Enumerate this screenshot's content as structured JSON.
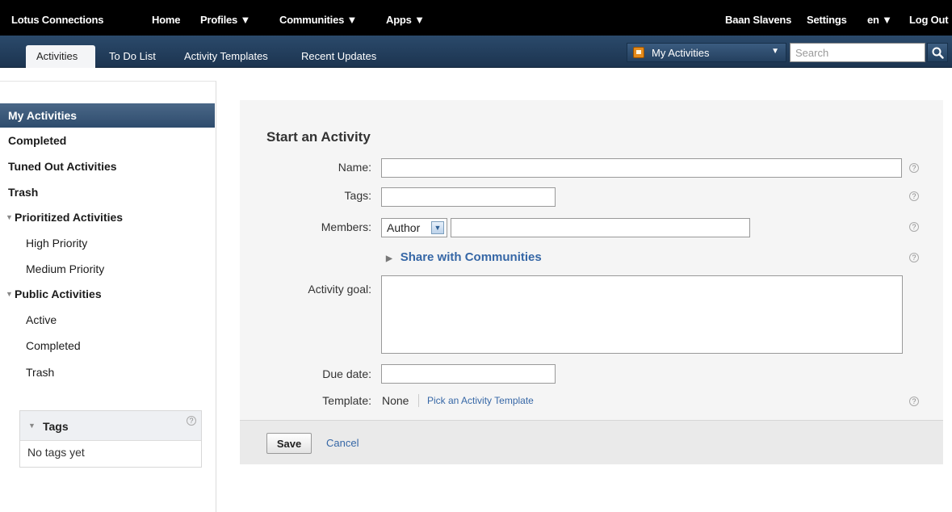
{
  "topbar": {
    "brand": "Lotus Connections",
    "nav": [
      "Home",
      "Profiles ▼",
      "Communities ▼",
      "Apps ▼"
    ],
    "user": "Baan Slavens",
    "settings": "Settings",
    "language": "en ▼",
    "logout": "Log Out"
  },
  "tabs": [
    "Activities",
    "To Do List",
    "Activity Templates",
    "Recent Updates"
  ],
  "context_select": "My Activities",
  "search": {
    "placeholder": "Search"
  },
  "sidebar": {
    "items": [
      "My Activities",
      "Completed",
      "Tuned Out Activities",
      "Trash",
      "Prioritized Activities",
      "High Priority",
      "Medium Priority",
      "Public Activities",
      "Active",
      "Completed",
      "Trash"
    ]
  },
  "tags_widget": {
    "title": "Tags",
    "empty": "No tags yet"
  },
  "help_glyph": "?",
  "form": {
    "title": "Start an Activity",
    "labels": {
      "name": "Name:",
      "tags": "Tags:",
      "members": "Members:",
      "goal": "Activity goal:",
      "due": "Due date:",
      "template": "Template:"
    },
    "member_role": "Author",
    "share_link": "Share with Communities",
    "template_value": "None",
    "template_link": "Pick an Activity Template",
    "save": "Save",
    "cancel": "Cancel"
  }
}
